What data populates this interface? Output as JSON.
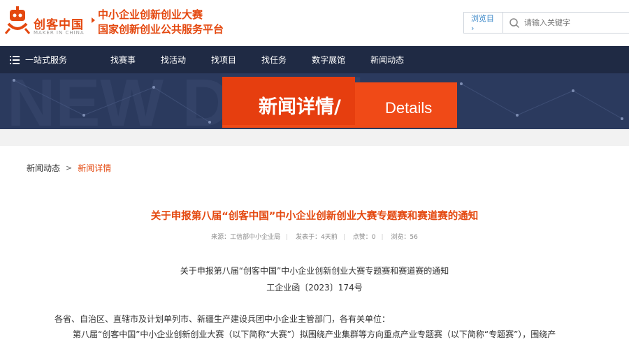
{
  "header": {
    "logo_text": "创客中国",
    "logo_sub": "MAKER IN CHINA",
    "slogan_line1": "中小企业创新创业大赛",
    "slogan_line2": "国家创新创业公共服务平台",
    "enter_label": "浏览目 ›",
    "search_placeholder": "请输入关键字"
  },
  "nav": {
    "menu_label": "一站式服务",
    "items": [
      "找赛事",
      "找活动",
      "找项目",
      "找任务",
      "数字展馆",
      "新闻动态"
    ]
  },
  "banner": {
    "title": "新闻详情/",
    "subtitle": "Details",
    "watermark": "NEW Details"
  },
  "breadcrumb": {
    "home": "新闻动态",
    "separator": ">",
    "current": "新闻详情"
  },
  "article": {
    "title": "关于申报第八届“创客中国”中小企业创新创业大赛专题赛和赛道赛的通知",
    "meta": {
      "source": "来源：工信部中小企业局",
      "published": "发表于：4天前",
      "likes": "点赞：0",
      "views": "浏览：56"
    },
    "doc_title": "关于申报第八届“创客中国”中小企业创新创业大赛专题赛和赛道赛的通知",
    "doc_number": "工企业函〔2023〕174号",
    "para1": "各省、自治区、直辖市及计划单列市、新疆生产建设兵团中小企业主管部门，各有关单位：",
    "para2": "第八届“创客中国”中小企业创新创业大赛（以下简称“大赛”）拟围绕产业集群等方向重点产业专题赛（以下简称“专题赛”），围绕产"
  },
  "colors": {
    "accent": "#e4480f",
    "nav_bg": "#1f2a44",
    "banner_bg": "#2b3a5e",
    "banner_tag": "#f04a17"
  }
}
